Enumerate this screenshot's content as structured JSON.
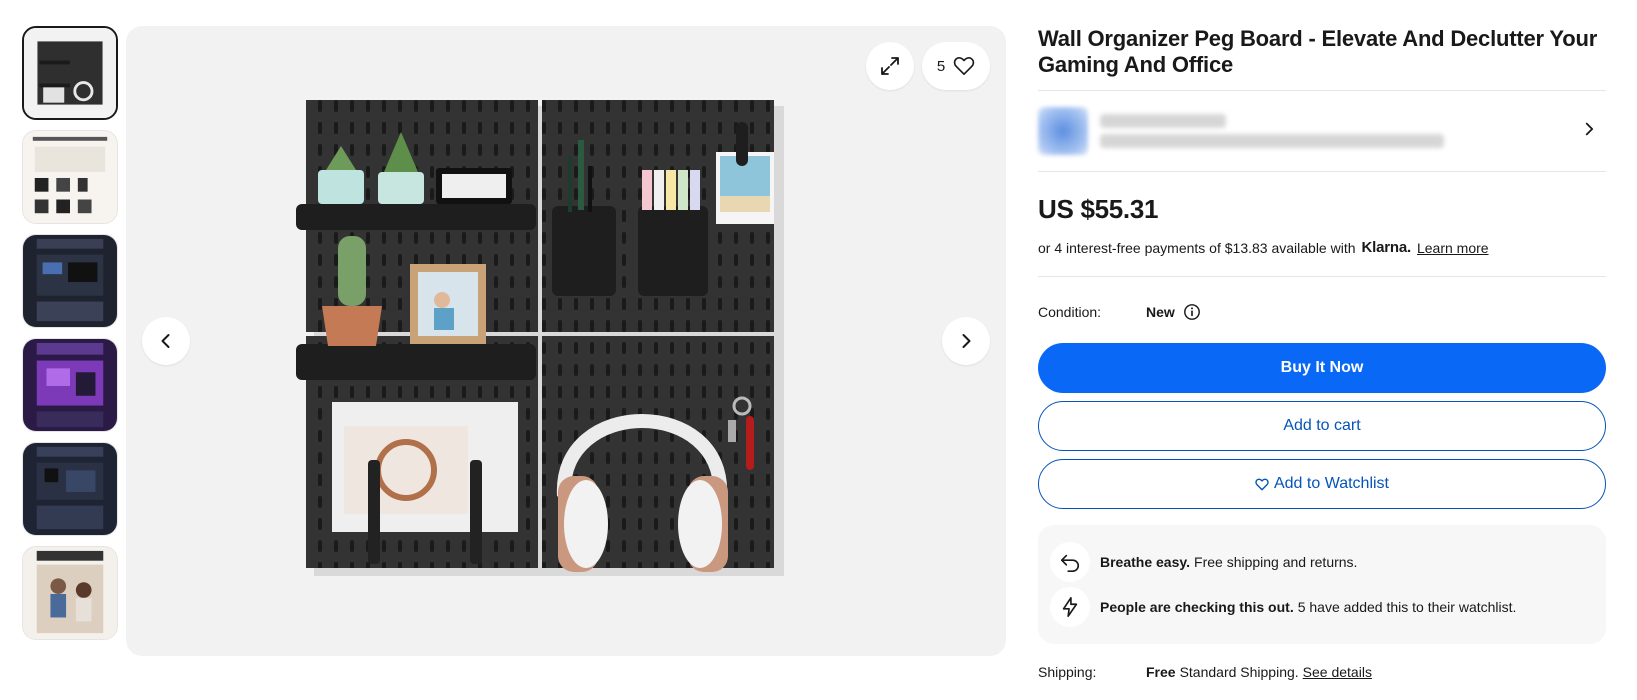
{
  "product": {
    "title": "Wall Organizer Peg Board - Elevate And Declutter Your Gaming And Office",
    "price": "US $55.31",
    "installments_text": "or 4 interest-free payments of $13.83 available with",
    "klarna_logo": "Klarna.",
    "learn_more": "Learn more",
    "condition_label": "Condition:",
    "condition_value": "New",
    "watch_count": "5"
  },
  "actions": {
    "buy_now": "Buy It Now",
    "add_to_cart": "Add to cart",
    "add_to_watchlist": "Add to Watchlist"
  },
  "notices": [
    {
      "icon": "return-arrow-icon",
      "title": "Breathe easy.",
      "text": "Free shipping and returns."
    },
    {
      "icon": "lightning-icon",
      "title": "People are checking this out.",
      "text": "5 have added this to their watchlist."
    }
  ],
  "shipping": {
    "label": "Shipping:",
    "free": "Free",
    "method": "Standard Shipping.",
    "details_link": "See details"
  },
  "colors": {
    "primary_button": "#0968f6",
    "outline_blue": "#0654ba",
    "image_bg": "#f2f2f2",
    "board": "#2f2f2f"
  }
}
